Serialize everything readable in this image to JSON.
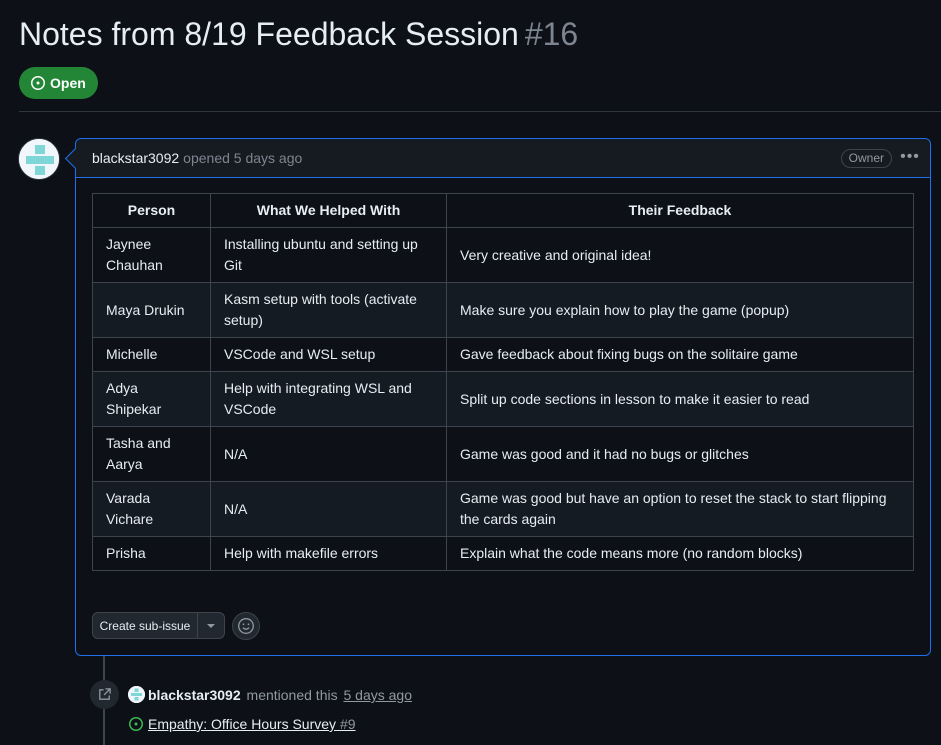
{
  "issue": {
    "title": "Notes from 8/19 Feedback Session",
    "number": "#16",
    "state": "Open",
    "state_color": "#238636"
  },
  "comment": {
    "author": "blackstar3092",
    "meta": "opened 5 days ago",
    "owner_badge": "Owner",
    "menu_icon": "kebab-horizontal-icon",
    "table": {
      "headers": [
        "Person",
        "What We Helped With",
        "Their Feedback"
      ],
      "rows": [
        [
          "Jaynee Chauhan",
          "Installing ubuntu and setting up Git",
          "Very creative and original idea!"
        ],
        [
          "Maya Drukin",
          "Kasm setup with tools (activate setup)",
          "Make sure you explain how to play the game (popup)"
        ],
        [
          "Michelle",
          "VSCode and WSL setup",
          "Gave feedback about fixing bugs on the solitaire game"
        ],
        [
          "Adya Shipekar",
          "Help with integrating WSL and VSCode",
          "Split up code sections in lesson to make it easier to read"
        ],
        [
          "Tasha and Aarya",
          "N/A",
          "Game was good and it had no bugs or glitches"
        ],
        [
          "Varada Vichare",
          "N/A",
          "Game was good but have an option to reset the stack to start flipping the cards again"
        ],
        [
          "Prisha",
          "Help with makefile errors",
          "Explain what the code means more (no random blocks)"
        ]
      ]
    },
    "create_sub_issue_label": "Create sub-issue"
  },
  "timeline": {
    "event": {
      "actor": "blackstar3092",
      "action": "mentioned this",
      "when": "5 days ago",
      "ref_title": "Empathy: Office Hours Survey",
      "ref_number": "#9"
    }
  },
  "colors": {
    "accent_border": "#1f6feb",
    "open_green": "#238636",
    "background": "#0d1117"
  }
}
